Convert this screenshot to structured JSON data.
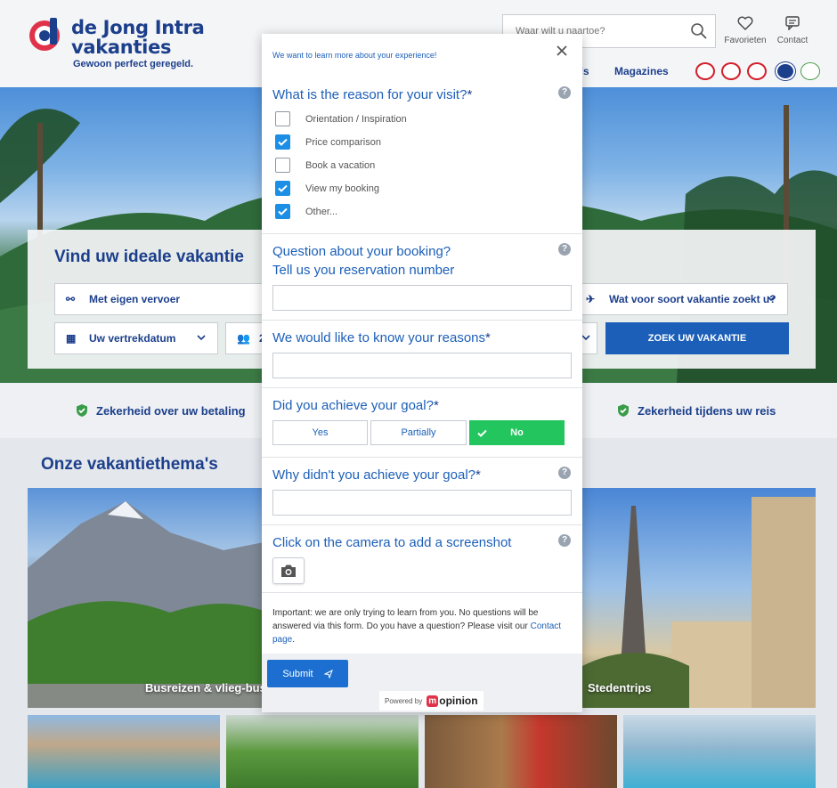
{
  "header": {
    "logo_line1": "de Jong Intra",
    "logo_line2": "vakanties",
    "tagline": "Gewoon perfect geregeld.",
    "search_placeholder": "Waar wilt u naartoe?",
    "favorites_label": "Favorieten",
    "contact_label": "Contact",
    "nav_partial": "'s",
    "nav_magazines": "Magazines",
    "badges": [
      "ANVR",
      "SGR",
      "SGRZ",
      "Calamiteitenfonds",
      "Vakantie"
    ]
  },
  "hero": {
    "title": "Vind uw ideale vakantie",
    "transport": "Met eigen vervoer",
    "departure": "Uw vertrekdatum",
    "persons_partial": "2",
    "vacation_type": "Wat voor soort vakantie zoekt u?",
    "search_button": "ZOEK UW VAKANTIE"
  },
  "trust": {
    "item1": "Zekerheid over uw betaling",
    "item2": "Zekerheid tijdens uw reis"
  },
  "themes": {
    "title": "Onze vakantiethema's",
    "tile1": "Busreizen & vlieg-bus",
    "tile2": "Stedentrips"
  },
  "modal": {
    "intro": "We want to learn more about your experience!",
    "q1": "What is the reason for your visit?",
    "q1_options": [
      {
        "label": "Orientation / Inspiration",
        "checked": false
      },
      {
        "label": "Price comparison",
        "checked": true
      },
      {
        "label": "Book a vacation",
        "checked": false
      },
      {
        "label": "View my booking",
        "checked": true
      },
      {
        "label": "Other...",
        "checked": true
      }
    ],
    "q2_line1": "Question about your booking?",
    "q2_line2": "Tell us you reservation number",
    "q3": "We would like to know your reasons",
    "q4": "Did you achieve your goal?",
    "q4_options": [
      "Yes",
      "Partially",
      "No"
    ],
    "q4_selected": "No",
    "q5": "Why didn't you achieve your goal?",
    "q6": "Click on the camera to add a screenshot",
    "note_text": "Important: we are only trying to learn from you. No questions will be answered via this form. Do you have a question? Please visit our",
    "note_link": "Contact page",
    "submit": "Submit",
    "powered_by": "Powered by",
    "brand": "opinion",
    "brand_m": "m",
    "required_mark": "*",
    "help_mark": "?"
  },
  "colors": {
    "brand_blue": "#1c3f8c",
    "link_blue": "#1c5fb8",
    "checkbox_blue": "#1c8ee6",
    "success_green": "#22c55e",
    "logo_red": "#e0334a"
  }
}
